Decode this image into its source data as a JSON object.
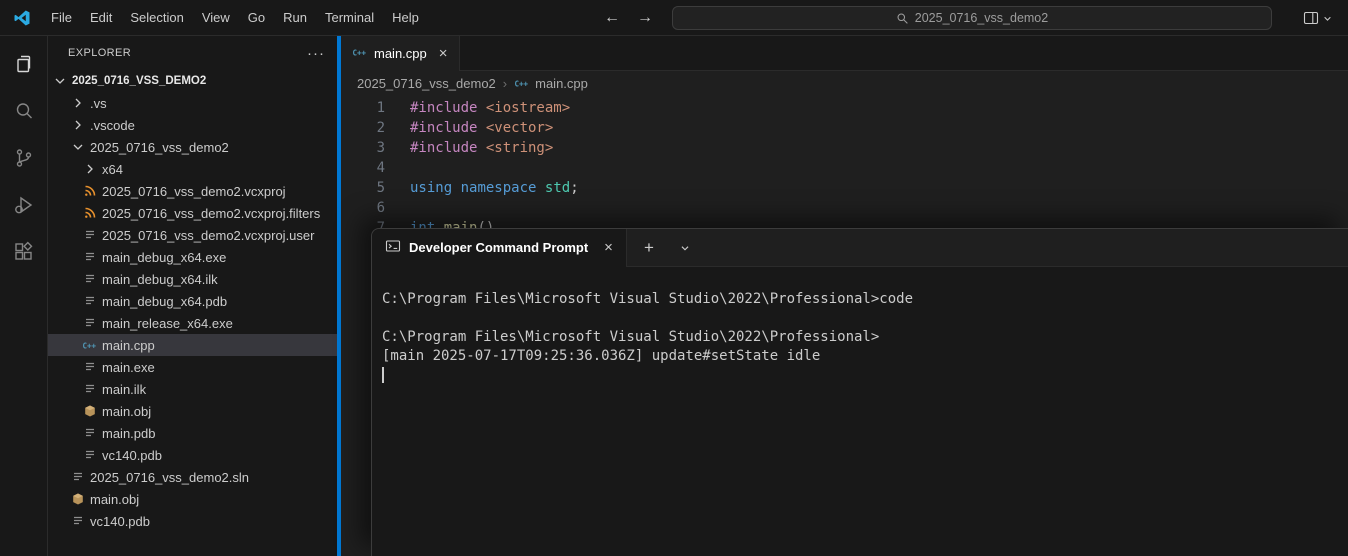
{
  "colors": {
    "accent_blue": "#0078d4",
    "syntax": {
      "pp": "#c586c0",
      "str": "#ce9178",
      "kw": "#569cd6",
      "type": "#4ec9b0",
      "fn": "#dcdcaa",
      "plain": "#cccccc"
    }
  },
  "ui": {
    "back_glyph": "←",
    "forward_glyph": "→",
    "close_glyph": "×",
    "more_glyph": "···",
    "plus_glyph": "+",
    "breadcrumb_separator": "›"
  },
  "title_bar": {
    "menus": [
      "File",
      "Edit",
      "Selection",
      "View",
      "Go",
      "Run",
      "Terminal",
      "Help"
    ],
    "search_value": "2025_0716_vss_demo2"
  },
  "activity_bar": {
    "items": [
      {
        "icon": "explorer-icon",
        "active": true
      },
      {
        "icon": "search-icon",
        "active": false
      },
      {
        "icon": "source-control-icon",
        "active": false
      },
      {
        "icon": "run-debug-icon",
        "active": false
      },
      {
        "icon": "extensions-icon",
        "active": false
      }
    ]
  },
  "explorer": {
    "header": "EXPLORER",
    "root": {
      "label": "2025_0716_VSS_DEMO2",
      "icon": "chevron-down"
    },
    "items": [
      {
        "label": ".vs",
        "level": 1,
        "icon": "chevron-right",
        "selected": false
      },
      {
        "label": ".vscode",
        "level": 1,
        "icon": "chevron-right",
        "selected": false
      },
      {
        "label": "2025_0716_vss_demo2",
        "level": 1,
        "icon": "chevron-down",
        "selected": false
      },
      {
        "label": "x64",
        "level": 2,
        "icon": "chevron-right",
        "selected": false
      },
      {
        "label": "2025_0716_vss_demo2.vcxproj",
        "level": 2,
        "icon": "rss",
        "selected": false
      },
      {
        "label": "2025_0716_vss_demo2.vcxproj.filters",
        "level": 2,
        "icon": "rss",
        "selected": false
      },
      {
        "label": "2025_0716_vss_demo2.vcxproj.user",
        "level": 2,
        "icon": "file",
        "selected": false
      },
      {
        "label": "main_debug_x64.exe",
        "level": 2,
        "icon": "file",
        "selected": false
      },
      {
        "label": "main_debug_x64.ilk",
        "level": 2,
        "icon": "file",
        "selected": false
      },
      {
        "label": "main_debug_x64.pdb",
        "level": 2,
        "icon": "file",
        "selected": false
      },
      {
        "label": "main_release_x64.exe",
        "level": 2,
        "icon": "file",
        "selected": false
      },
      {
        "label": "main.cpp",
        "level": 2,
        "icon": "cpp",
        "selected": true
      },
      {
        "label": "main.exe",
        "level": 2,
        "icon": "file",
        "selected": false
      },
      {
        "label": "main.ilk",
        "level": 2,
        "icon": "file",
        "selected": false
      },
      {
        "label": "main.obj",
        "level": 2,
        "icon": "obj",
        "selected": false
      },
      {
        "label": "main.pdb",
        "level": 2,
        "icon": "file",
        "selected": false
      },
      {
        "label": "vc140.pdb",
        "level": 2,
        "icon": "file",
        "selected": false
      },
      {
        "label": "2025_0716_vss_demo2.sln",
        "level": 1,
        "icon": "file",
        "selected": false
      },
      {
        "label": "main.obj",
        "level": 1,
        "icon": "obj",
        "selected": false
      },
      {
        "label": "vc140.pdb",
        "level": 1,
        "icon": "file",
        "selected": false
      }
    ]
  },
  "editor": {
    "tab": {
      "label": "main.cpp",
      "icon": "cpp"
    },
    "breadcrumb": [
      {
        "label": "2025_0716_vss_demo2",
        "icon": null
      },
      {
        "label": "main.cpp",
        "icon": "cpp"
      }
    ],
    "code_lines": [
      {
        "num": "1",
        "tokens": [
          {
            "t": "#include ",
            "c": "pp"
          },
          {
            "t": "<iostream>",
            "c": "str"
          }
        ]
      },
      {
        "num": "2",
        "tokens": [
          {
            "t": "#include ",
            "c": "pp"
          },
          {
            "t": "<vector>",
            "c": "str"
          }
        ]
      },
      {
        "num": "3",
        "tokens": [
          {
            "t": "#include ",
            "c": "pp"
          },
          {
            "t": "<string>",
            "c": "str"
          }
        ]
      },
      {
        "num": "4",
        "tokens": []
      },
      {
        "num": "5",
        "tokens": [
          {
            "t": "using",
            "c": "kw"
          },
          {
            "t": " ",
            "c": "plain"
          },
          {
            "t": "namespace",
            "c": "kw"
          },
          {
            "t": " ",
            "c": "plain"
          },
          {
            "t": "std",
            "c": "type"
          },
          {
            "t": ";",
            "c": "plain"
          }
        ]
      },
      {
        "num": "6",
        "tokens": []
      },
      {
        "num": "7",
        "tokens": [
          {
            "t": "int",
            "c": "kw"
          },
          {
            "t": " ",
            "c": "plain"
          },
          {
            "t": "main",
            "c": "fn"
          },
          {
            "t": "()",
            "c": "plain"
          }
        ]
      }
    ]
  },
  "terminal": {
    "tab": {
      "label": "Developer Command Prompt",
      "icon": "terminal-icon"
    },
    "lines": [
      "C:\\Program Files\\Microsoft Visual Studio\\2022\\Professional>code",
      "",
      "C:\\Program Files\\Microsoft Visual Studio\\2022\\Professional>",
      "[main 2025-07-17T09:25:36.036Z] update#setState idle"
    ]
  }
}
